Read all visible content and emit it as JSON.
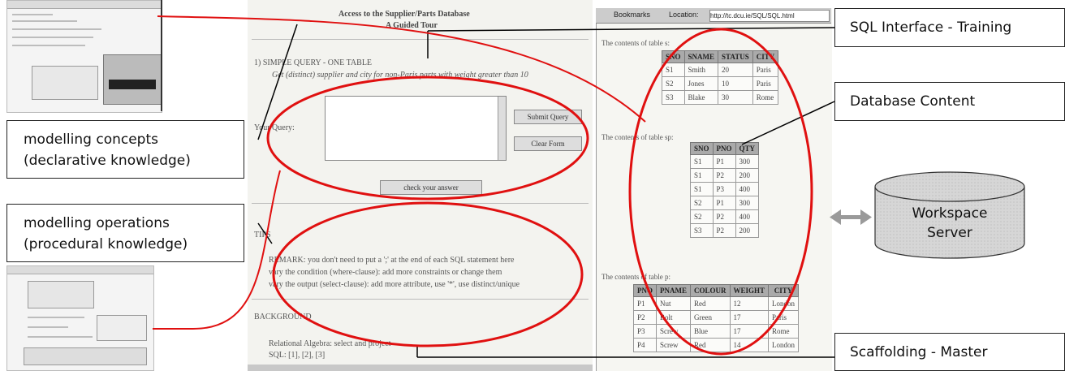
{
  "labels": {
    "sql_interface": "SQL Interface - Training",
    "database_content": "Database Content",
    "scaffolding": "Scaffolding - Master",
    "concepts_line1": "modelling concepts",
    "concepts_line2": "(declarative knowledge)",
    "operations_line1": "modelling operations",
    "operations_line2": "(procedural knowledge)",
    "workspace_line1": "Workspace",
    "workspace_line2": "Server"
  },
  "screenshot": {
    "title_line1": "Access to the Supplier/Parts Database",
    "title_line2": "A Guided Tour",
    "section_title": "1) SIMPLE QUERY - ONE TABLE",
    "task": "Get (distinct) supplier and city for non-Paris parts with weight greater than 10",
    "query_label": "Your Query:",
    "submit_button": "Submit Query",
    "clear_button": "Clear Form",
    "check_button": "check your answer",
    "tips_heading": "TIPS",
    "tip1": "REMARK: you don't need to put a ';' at the end of each SQL statement here",
    "tip2": "vary the condition (where-clause): add more constraints or change them",
    "tip3": "vary the output (select-clause): add more attribute, use '*', use distinct/unique",
    "background_heading": "BACKGROUND",
    "bg1": "Relational Algebra: select and project",
    "bg2": "SQL: [1], [2], [3]"
  },
  "browser": {
    "bookmarks": "Bookmarks",
    "location": "Location:",
    "url": "http://tc.dcu.ie/SQL/SQL.html"
  },
  "tables": [
    {
      "caption": "The contents of table s:",
      "headers": [
        "SNO",
        "SNAME",
        "STATUS",
        "CITY"
      ],
      "rows": [
        [
          "S1",
          "Smith",
          "20",
          "Paris"
        ],
        [
          "S2",
          "Jones",
          "10",
          "Paris"
        ],
        [
          "S3",
          "Blake",
          "30",
          "Rome"
        ]
      ]
    },
    {
      "caption": "The contents of table sp:",
      "headers": [
        "SNO",
        "PNO",
        "QTY"
      ],
      "rows": [
        [
          "S1",
          "P1",
          "300"
        ],
        [
          "S1",
          "P2",
          "200"
        ],
        [
          "S1",
          "P3",
          "400"
        ],
        [
          "S2",
          "P1",
          "300"
        ],
        [
          "S2",
          "P2",
          "400"
        ],
        [
          "S3",
          "P2",
          "200"
        ]
      ]
    },
    {
      "caption": "The contents of table p:",
      "headers": [
        "PNO",
        "PNAME",
        "COLOUR",
        "WEIGHT",
        "CITY"
      ],
      "rows": [
        [
          "P1",
          "Nut",
          "Red",
          "12",
          "London"
        ],
        [
          "P2",
          "Bolt",
          "Green",
          "17",
          "Paris"
        ],
        [
          "P3",
          "Screw",
          "Blue",
          "17",
          "Rome"
        ],
        [
          "P4",
          "Screw",
          "Red",
          "14",
          "London"
        ]
      ]
    }
  ],
  "colors": {
    "highlight": "#e01010",
    "cylinder": "#d4d4d4",
    "arrow": "#9a9a9a"
  }
}
